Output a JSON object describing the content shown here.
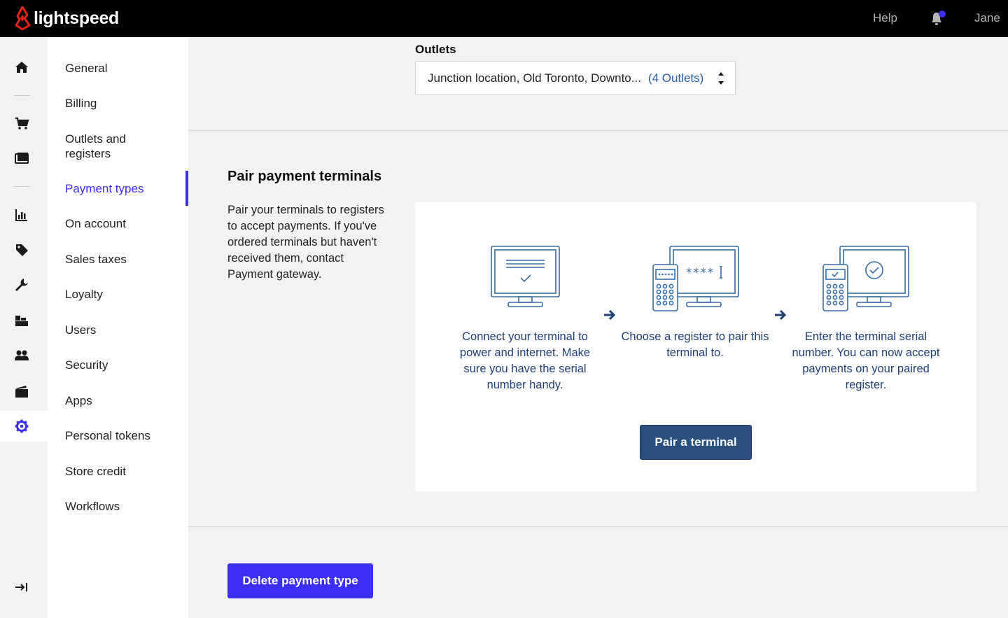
{
  "topbar": {
    "brand": "lightspeed",
    "help_label": "Help",
    "user_name": "Jane",
    "notification_dot_color": "#3b2ef5"
  },
  "rail": {
    "icons": [
      "home-icon",
      "cart-icon",
      "register-icon",
      "reports-icon",
      "tag-icon",
      "wrench-icon",
      "inventory-icon",
      "customers-icon",
      "folder-icon",
      "settings-icon",
      "collapse-icon"
    ],
    "active": "settings-icon"
  },
  "subnav": {
    "items": [
      {
        "label": "General"
      },
      {
        "label": "Billing"
      },
      {
        "label": "Outlets and registers"
      },
      {
        "label": "Payment types"
      },
      {
        "label": "On account"
      },
      {
        "label": "Sales taxes"
      },
      {
        "label": "Loyalty"
      },
      {
        "label": "Users"
      },
      {
        "label": "Security"
      },
      {
        "label": "Apps"
      },
      {
        "label": "Personal tokens"
      },
      {
        "label": "Store credit"
      },
      {
        "label": "Workflows"
      }
    ],
    "active_label": "Payment types"
  },
  "outlets": {
    "label": "Outlets",
    "value": "Junction location, Old Toronto, Downto...",
    "count": "(4 Outlets)"
  },
  "pair_section": {
    "title": "Pair payment terminals",
    "description": "Pair your terminals to registers to accept payments. If you've ordered terminals but haven't received them, contact Payment gateway.",
    "steps": [
      {
        "text": "Connect your terminal to power and internet. Make sure you have the serial number handy."
      },
      {
        "text": "Choose a register to pair this terminal to."
      },
      {
        "text": "Enter the terminal serial number. You can now accept payments on your paired register."
      }
    ],
    "button_label": "Pair a terminal"
  },
  "footer": {
    "delete_label": "Delete payment type"
  },
  "colors": {
    "accent": "#3b2ef5",
    "navy": "#2a4f7c",
    "illustration": "#3a6ea5"
  }
}
